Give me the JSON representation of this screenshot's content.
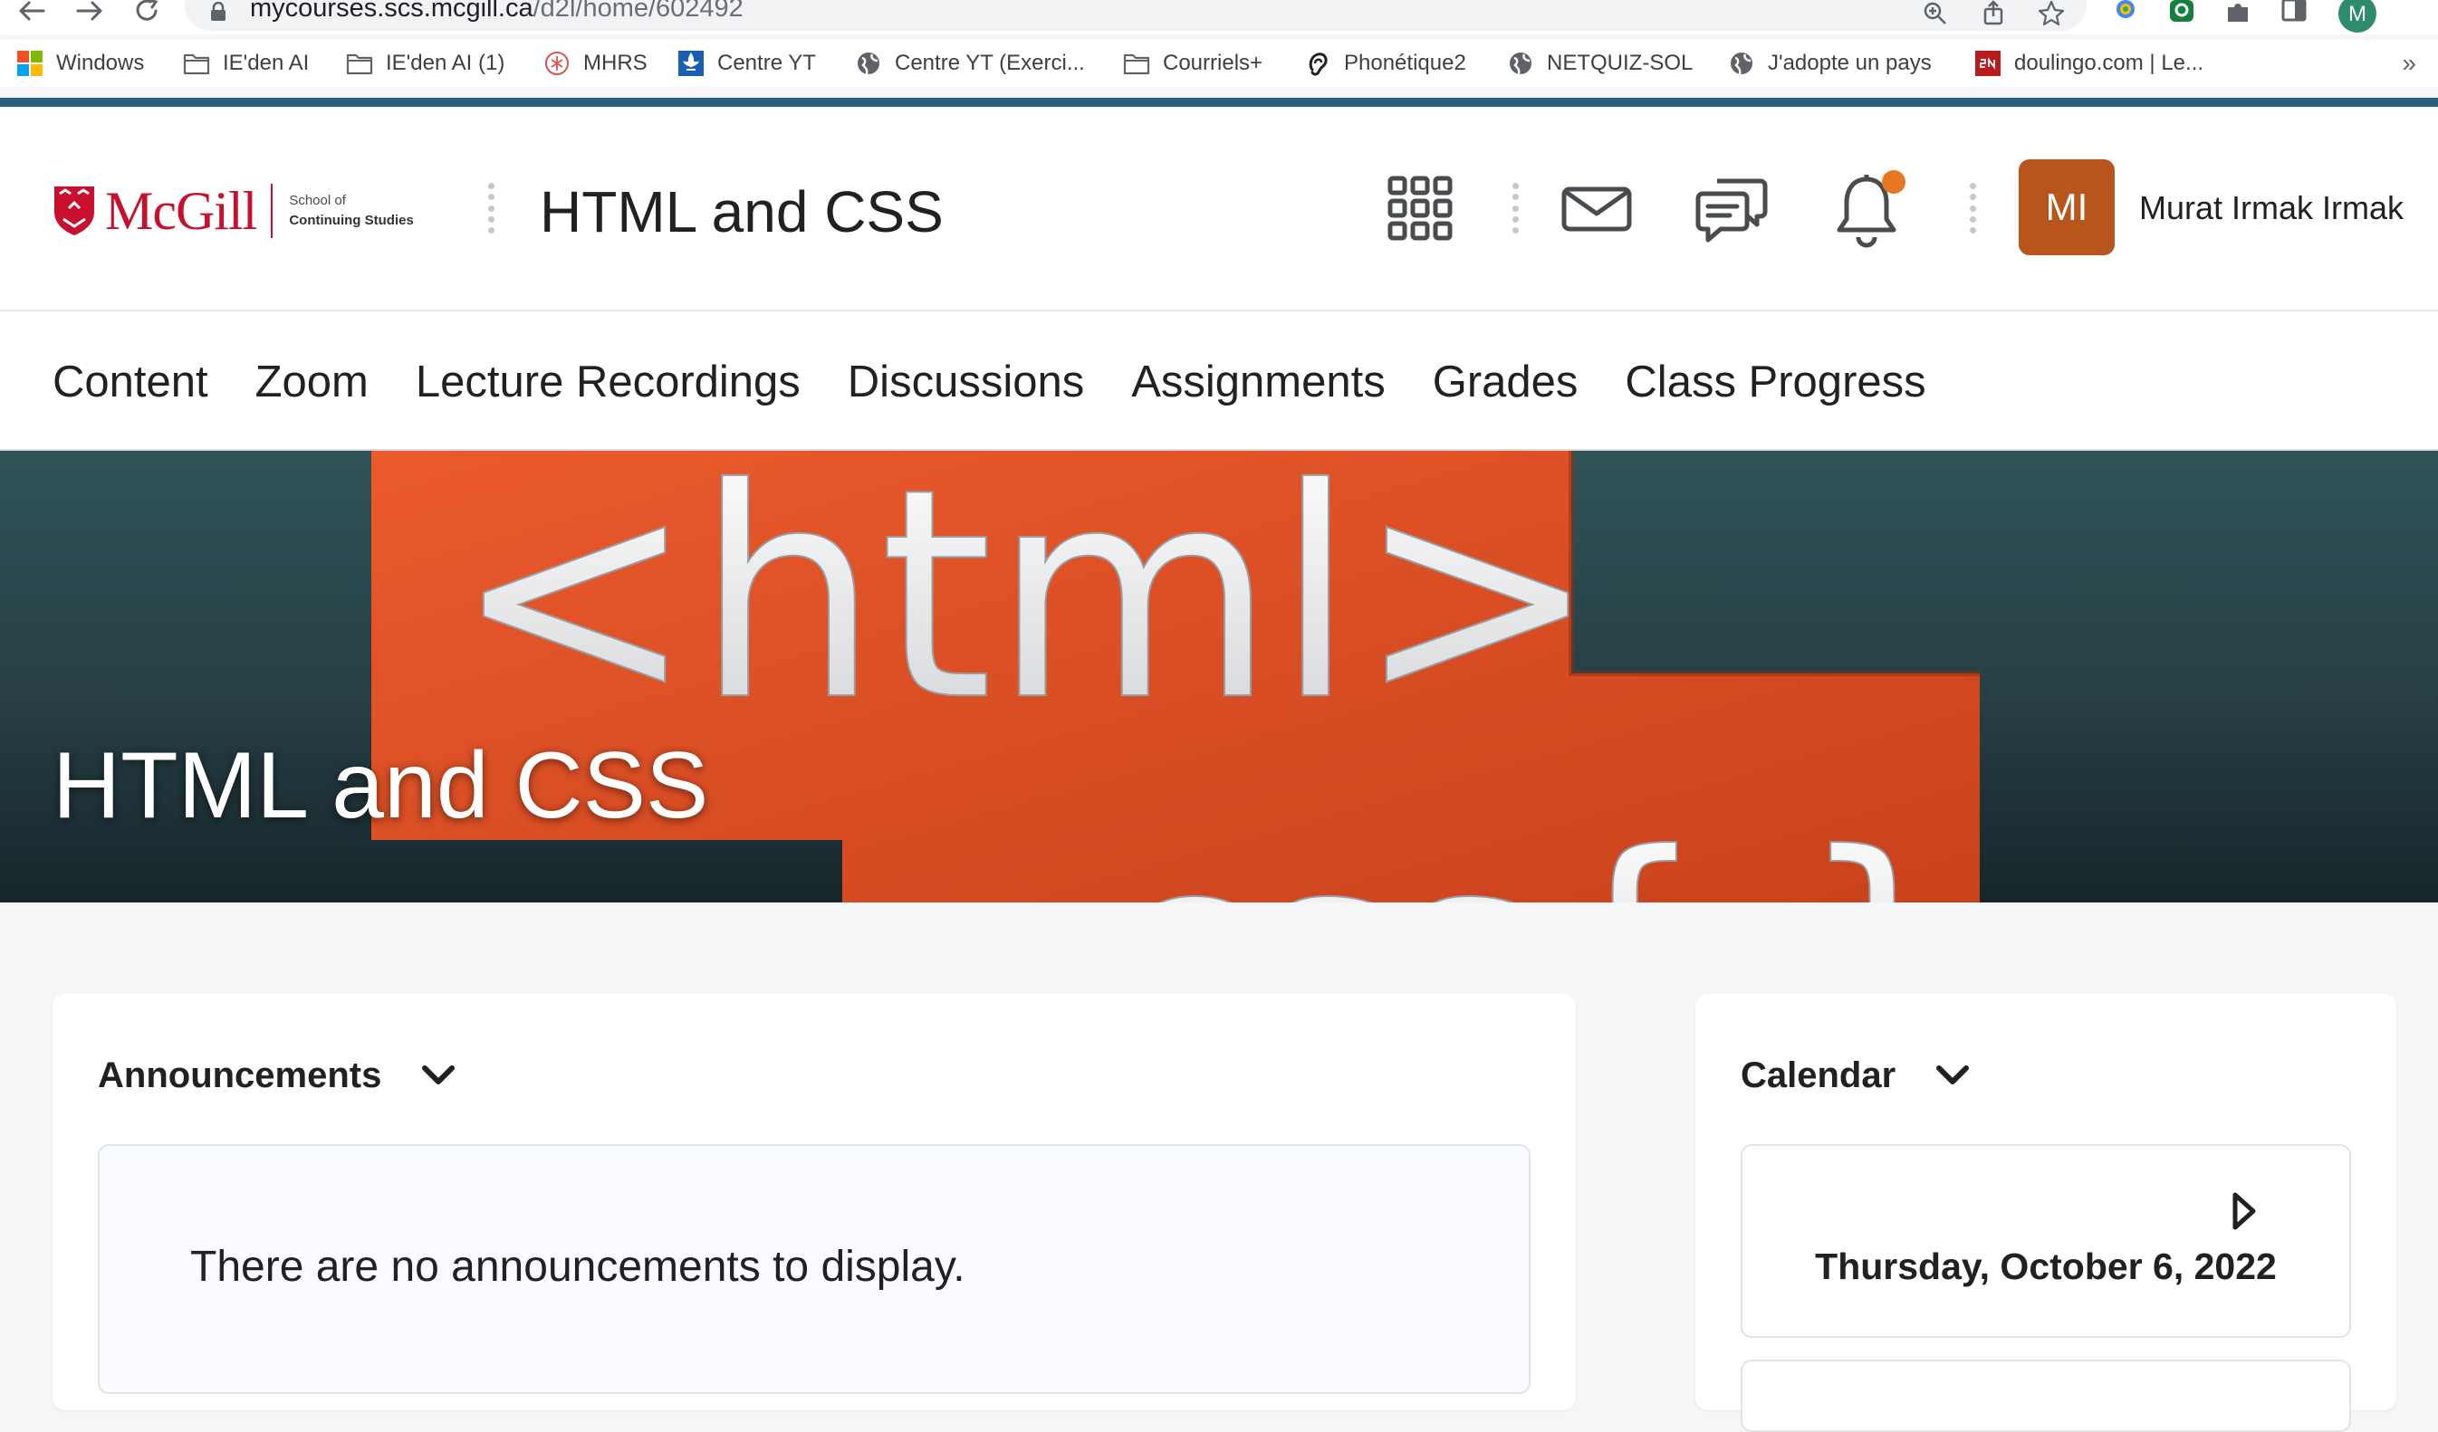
{
  "browser": {
    "url_host": "mycourses.scs.mcgill.ca",
    "url_path": "/d2l/home/602492",
    "profile_initial": "M",
    "bookmarks": [
      {
        "label": "Windows",
        "icon": "windows-logo-icon"
      },
      {
        "label": "IE'den AI",
        "icon": "folder-icon"
      },
      {
        "label": "IE'den AI (1)",
        "icon": "folder-icon"
      },
      {
        "label": "MHRS",
        "icon": "mhrs-logo-icon"
      },
      {
        "label": "Centre YT",
        "icon": "quebec-fleur-de-lis-icon"
      },
      {
        "label": "Centre YT (Exerci...",
        "icon": "globe-icon"
      },
      {
        "label": "Courriels+",
        "icon": "folder-icon"
      },
      {
        "label": "Phonétique2",
        "icon": "ear-icon"
      },
      {
        "label": "NETQUIZ-SOL",
        "icon": "globe-icon"
      },
      {
        "label": "J'adopte un pays",
        "icon": "globe-icon"
      },
      {
        "label": "doulingo.com | Le...",
        "icon": "sn-logo-icon"
      }
    ],
    "more_bookmarks": "»"
  },
  "header": {
    "logo_word": "McGill",
    "logo_sub_1": "School of",
    "logo_sub_2": "Continuing Studies",
    "course_title": "HTML and CSS",
    "user_initials": "MI",
    "user_name": "Murat Irmak Irmak"
  },
  "nav": {
    "items": [
      "Content",
      "Zoom",
      "Lecture Recordings",
      "Discussions",
      "Assignments",
      "Grades",
      "Class Progress"
    ]
  },
  "banner": {
    "title": "HTML and CSS",
    "image_text_1": "<html>",
    "image_text_2": "css{ }"
  },
  "announcements": {
    "title": "Announcements",
    "empty_message": "There are no announcements to display."
  },
  "calendar": {
    "title": "Calendar",
    "date": "Thursday, October 6, 2022"
  },
  "colors": {
    "accent_bar": "#2c5f7c",
    "mcgill_red": "#c8102e",
    "avatar_bg": "#b7551d",
    "notification_dot": "#e87722",
    "banner_orange": "#e2572b"
  }
}
